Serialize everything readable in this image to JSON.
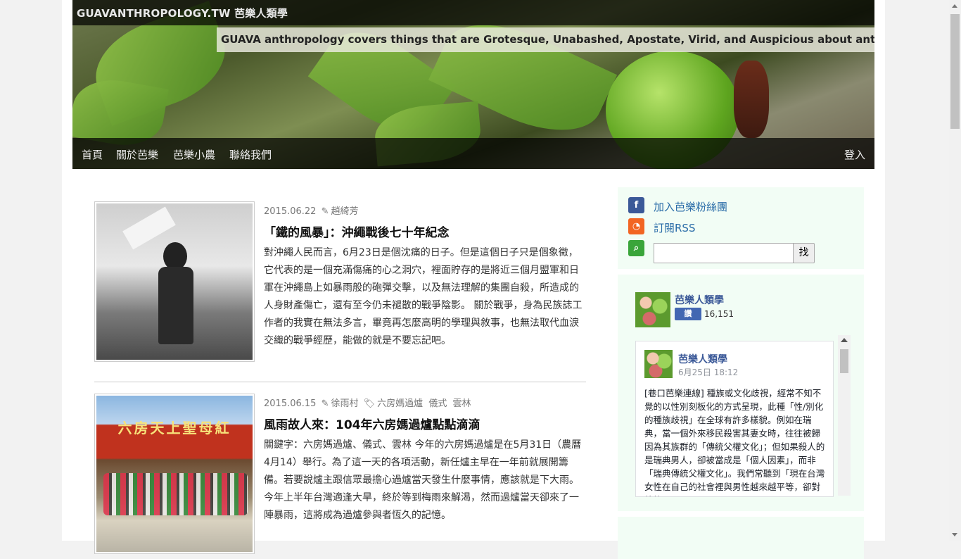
{
  "site": {
    "title": "GUAVANTHROPOLOGY.TW 芭樂人類學",
    "tagline": "GUAVA anthropology covers things that are Grotesque, Unabashed, Apostate, Virid, and Auspicious about anthropology!"
  },
  "nav": {
    "items": [
      "首頁",
      "關於芭樂",
      "芭樂小農",
      "聯絡我們"
    ],
    "login": "登入"
  },
  "posts": [
    {
      "date": "2015.06.22",
      "author": "趙綺芳",
      "tags": [],
      "title": "「鐵的風暴」：沖繩戰後七十年紀念",
      "excerpt": "對沖繩人民而言，6月23日是個沈痛的日子。但是這個日子只是個象徵，它代表的是一個充滿傷痛的心之洞穴，裡面貯存的是將近三個月盟軍和日軍在沖繩島上如暴雨般的砲彈交擊，以及無法理解的集團自殺，所造成的人身財產傷亡，還有至今仍未褪散的戰爭陰影。 關於戰爭，身為民族誌工作者的我實在無法多言，畢竟再怎麼高明的學理與敘事，也無法取代血淚交織的戰爭經歷，能做的就是不要忘記吧。"
    },
    {
      "date": "2015.06.15",
      "author": "徐雨村",
      "tags": [
        "六房媽過爐",
        "儀式",
        "雲林"
      ],
      "title": "風雨故人來：104年六房媽過爐點點滴滴",
      "excerpt": "關鍵字：六房媽過爐、儀式、雲林 今年的六房媽過爐是在5月31日（農曆4月14）舉行。為了這一天的各項活動，新任爐主早在一年前就展開籌備。若要說爐主跟信眾最擔心過爐當天發生什麼事情，應該就是下大雨。今年上半年台灣適逢大旱，終於等到梅雨來解渴，然而過爐當天卻來了一陣暴雨，這將成為過爐參與者恆久的記憶。",
      "photo_sign": "六房天上聖母紅"
    }
  ],
  "sidebar": {
    "fan_link": "加入芭樂粉絲團",
    "rss_link": "訂閱RSS",
    "search_placeholder": "",
    "search_button": "找",
    "fb_page_name": "芭樂人類學",
    "fb_like_label": "讚",
    "fb_like_count": "16,151",
    "feed": {
      "page_name": "芭樂人類學",
      "time": "6月25日 18:12",
      "text": "[巷口芭樂連線] 種族或文化歧視，經常不知不覺的以性別刻板化的方式呈現，此種「性/別化的種族歧視」在全球有許多樣貌。例如在瑞典，當一個外來移民殺害其妻女時，往往被歸因為其族群的「傳統父權文化」；但如果殺人的是瑞典男人，卻被當成是「個人因素」，而非「瑞典傳統父權文化」。我們常聽到「現在台灣女性在自己的社會裡與男性越來越平等，卻對外籍..."
    }
  },
  "colors": {
    "link": "#2a6ca8",
    "sidebar_bg": "#f2fdf5",
    "fb_blue": "#3b5998",
    "rss_orange": "#f26522",
    "search_green": "#3aa53a"
  }
}
